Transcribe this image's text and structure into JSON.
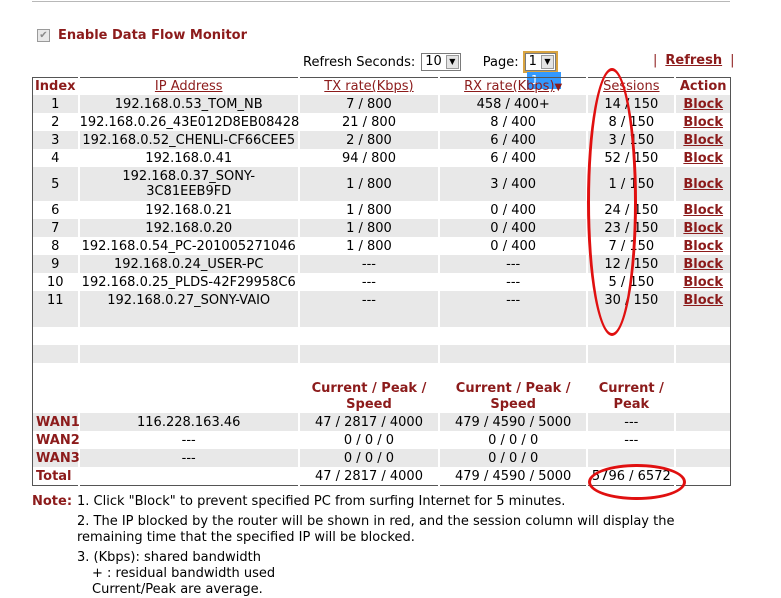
{
  "enable": {
    "label": "Enable Data Flow Monitor",
    "checked": true
  },
  "refresh": {
    "seconds_label": "Refresh Seconds:",
    "seconds_value": "10",
    "page_label": "Page:",
    "page_value": "1",
    "dropdown_option": "1",
    "link_label": "Refresh"
  },
  "table": {
    "headers": {
      "index": "Index",
      "ip": "IP Address",
      "tx": "TX rate(Kbps)",
      "rx": "RX rate(Kbps)",
      "sessions": "Sessions",
      "action": "Action"
    },
    "rows": [
      {
        "index": "1",
        "ip": "192.168.0.53_TOM_NB",
        "tx": "7 / 800",
        "rx": "458 / 400+",
        "sessions": "14 / 150",
        "action": "Block"
      },
      {
        "index": "2",
        "ip": "192.168.0.26_43E012D8EB08428",
        "tx": "21 / 800",
        "rx": "8 / 400",
        "sessions": "8 / 150",
        "action": "Block"
      },
      {
        "index": "3",
        "ip": "192.168.0.52_CHENLI-CF66CEE5",
        "tx": "2 / 800",
        "rx": "6 / 400",
        "sessions": "3 / 150",
        "action": "Block"
      },
      {
        "index": "4",
        "ip": "192.168.0.41",
        "tx": "94 / 800",
        "rx": "6 / 400",
        "sessions": "52 / 150",
        "action": "Block"
      },
      {
        "index": "5",
        "ip": "192.168.0.37_SONY-3C81EEB9FD",
        "tx": "1 / 800",
        "rx": "3 / 400",
        "sessions": "1 / 150",
        "action": "Block"
      },
      {
        "index": "6",
        "ip": "192.168.0.21",
        "tx": "1 / 800",
        "rx": "0 / 400",
        "sessions": "24 / 150",
        "action": "Block"
      },
      {
        "index": "7",
        "ip": "192.168.0.20",
        "tx": "1 / 800",
        "rx": "0 / 400",
        "sessions": "23 / 150",
        "action": "Block"
      },
      {
        "index": "8",
        "ip": "192.168.0.54_PC-201005271046",
        "tx": "1 / 800",
        "rx": "0 / 400",
        "sessions": "7 / 150",
        "action": "Block"
      },
      {
        "index": "9",
        "ip": "192.168.0.24_USER-PC",
        "tx": "---",
        "rx": "---",
        "sessions": "12 / 150",
        "action": "Block"
      },
      {
        "index": "10",
        "ip": "192.168.0.25_PLDS-42F29958C6",
        "tx": "---",
        "rx": "---",
        "sessions": "5 / 150",
        "action": "Block"
      },
      {
        "index": "11",
        "ip": "192.168.0.27_SONY-VAIO",
        "tx": "---",
        "rx": "---",
        "sessions": "30 / 150",
        "action": "Block"
      }
    ],
    "summary_headers": {
      "tx": "Current / Peak / Speed",
      "rx": "Current / Peak / Speed",
      "sessions": "Current / Peak"
    },
    "wan": [
      {
        "label": "WAN1",
        "ip": "116.228.163.46",
        "tx": "47 / 2817 / 4000",
        "rx": "479 / 4590 / 5000",
        "sessions": "---"
      },
      {
        "label": "WAN2",
        "ip": "---",
        "tx": "0 / 0 / 0",
        "rx": "0 / 0 / 0",
        "sessions": "---"
      },
      {
        "label": "WAN3",
        "ip": "---",
        "tx": "0 / 0 / 0",
        "rx": "0 / 0 / 0",
        "sessions": ""
      },
      {
        "label": "Total",
        "ip": "",
        "tx": "47 / 2817 / 4000",
        "rx": "479 / 4590 / 5000",
        "sessions": "5796 / 6572"
      }
    ]
  },
  "note": {
    "label": "Note:",
    "item1": "1. Click \"Block\" to prevent specified PC from surfing Internet for 5 minutes.",
    "item2": "2. The IP blocked by the router will be shown in red, and the session column will display the remaining time that the specified IP will be blocked.",
    "item3_a": "3. (Kbps): shared bandwidth",
    "item3_b": "+ : residual bandwidth used",
    "item3_c": "Current/Peak are average."
  },
  "colors": {
    "accent": "#8c1b1b",
    "shade": "#e8e8e8",
    "highlight": "#e01010",
    "dropdown": "#3399ff"
  }
}
